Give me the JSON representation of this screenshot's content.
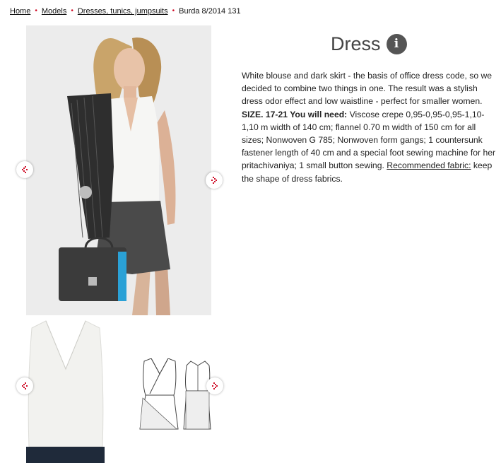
{
  "breadcrumb": {
    "items": [
      "Home",
      "Models",
      "Dresses, tunics, jumpsuits"
    ],
    "current": "Burda 8/2014 131",
    "separator": "•"
  },
  "product": {
    "title": "Dress",
    "info_icon": "info-icon",
    "description_intro": "White blouse and dark skirt - the basis of office dress code, so we decided to combine two things in one. The result was a stylish dress odor effect and low waistline - perfect for smaller women.",
    "size_label": "SIZE. 17-21 You will need:",
    "needs_text": " Viscose crepe 0,95-0,95-0,95-1,10-1,10 m width of 140 cm; flannel 0.70 m width of 150 cm for all sizes; Nonwoven G 785; Nonwoven form gangs; 1 countersunk fastener length of 40 cm and a special foot sewing machine for her pritachivaniya; 1 small button sewing. ",
    "fabric_link": "Recommended fabric:",
    "fabric_text": " keep the shape of dress fabrics."
  },
  "gallery": {
    "prev_icon": "chevron-left-icon",
    "next_icon": "chevron-right-icon"
  },
  "colors": {
    "accent": "#d0102a",
    "title": "#444444",
    "skirt": "#4a4a4a",
    "jacket": "#2e2e2e"
  }
}
